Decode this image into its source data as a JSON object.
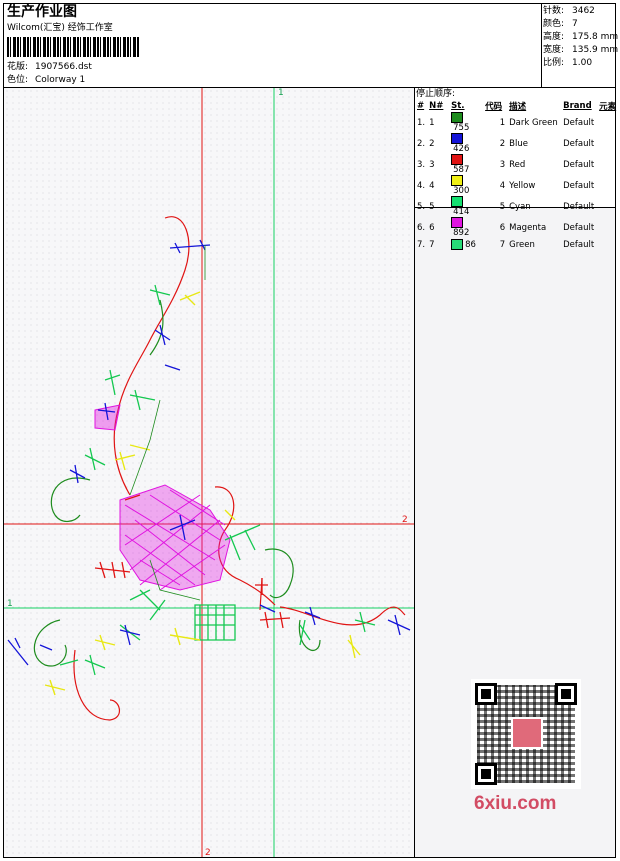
{
  "header": {
    "title": "生产作业图",
    "company": "Wilcom(汇宝) 经饰工作室",
    "design_label": "花版:",
    "design_value": "1907566.dst",
    "colorway_label": "色位:",
    "colorway_value": "Colorway 1"
  },
  "stats": {
    "stitches_label": "针数:",
    "stitches_value": "3462",
    "colors_label": "颜色:",
    "colors_value": "7",
    "height_label": "高度:",
    "height_value": "175.8 mm",
    "width_label": "宽度:",
    "width_value": "135.9 mm",
    "scale_label": "比例:",
    "scale_value": "1.00"
  },
  "color_table": {
    "heading": "停止顺序:",
    "columns": [
      "#",
      "N#",
      "St.",
      "代码",
      "描述",
      "Brand",
      "元素"
    ],
    "rows": [
      {
        "idx": "1.",
        "n": "1",
        "color": "#1e8c1e",
        "st": "755",
        "code": "1",
        "desc": "Dark Green",
        "brand": "Default"
      },
      {
        "idx": "2.",
        "n": "2",
        "color": "#1414d8",
        "st": "426",
        "code": "2",
        "desc": "Blue",
        "brand": "Default"
      },
      {
        "idx": "3.",
        "n": "3",
        "color": "#e01414",
        "st": "587",
        "code": "3",
        "desc": "Red",
        "brand": "Default"
      },
      {
        "idx": "4.",
        "n": "4",
        "color": "#f0f014",
        "st": "300",
        "code": "4",
        "desc": "Yellow",
        "brand": "Default"
      },
      {
        "idx": "5.",
        "n": "5",
        "color": "#14e070",
        "st": "414",
        "code": "5",
        "desc": "Cyan",
        "brand": "Default"
      },
      {
        "idx": "6.",
        "n": "6",
        "color": "#e014e0",
        "st": "892",
        "code": "6",
        "desc": "Magenta",
        "brand": "Default"
      },
      {
        "idx": "7.",
        "n": "7",
        "color": "#28dc78",
        "st": "86",
        "code": "7",
        "desc": "Green",
        "brand": "Default"
      }
    ]
  },
  "axes": {
    "top_green": "1",
    "right_red": "2",
    "left_green": "1",
    "bottom_red": "2"
  },
  "watermark": "6xiu.com"
}
